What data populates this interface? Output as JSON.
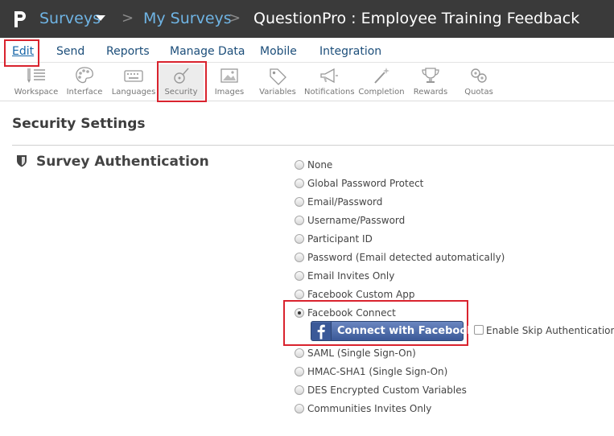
{
  "header": {
    "breadcrumbs": [
      "Surveys",
      "My Surveys",
      "QuestionPro : Employee Training Feedback"
    ],
    "separator": ">"
  },
  "main_tabs": [
    "Edit",
    "Send",
    "Reports",
    "Manage Data",
    "Mobile",
    "Integration"
  ],
  "toolbar": [
    {
      "label": "Workspace",
      "icon": "workspace-icon"
    },
    {
      "label": "Interface",
      "icon": "palette-icon"
    },
    {
      "label": "Languages",
      "icon": "keyboard-icon"
    },
    {
      "label": "Security",
      "icon": "lock-icon",
      "active": true
    },
    {
      "label": "Images",
      "icon": "image-icon"
    },
    {
      "label": "Variables",
      "icon": "tag-icon"
    },
    {
      "label": "Notifications",
      "icon": "megaphone-icon"
    },
    {
      "label": "Completion",
      "icon": "magic-wand-icon"
    },
    {
      "label": "Rewards",
      "icon": "trophy-icon"
    },
    {
      "label": "Quotas",
      "icon": "quota-icon"
    }
  ],
  "page": {
    "title": "Security Settings",
    "section": "Survey Authentication"
  },
  "auth_options": [
    "None",
    "Global Password Protect",
    "Email/Password",
    "Username/Password",
    "Participant ID",
    "Password (Email detected automatically)",
    "Email Invites Only",
    "Facebook Custom App",
    "Facebook Connect",
    "SAML (Single Sign-On)",
    "HMAC-SHA1 (Single Sign-On)",
    "DES Encrypted Custom Variables",
    "Communities Invites Only"
  ],
  "selected_option": "Facebook Connect",
  "facebook_button": {
    "label": "Connect with Facebook",
    "color": "#3b5998"
  },
  "skip_auth": {
    "label": "Enable Skip Authentication",
    "checked": false
  },
  "colors": {
    "topbar": "#3a3a3a",
    "link": "#6fb4e4",
    "highlight": "#d9232e"
  }
}
